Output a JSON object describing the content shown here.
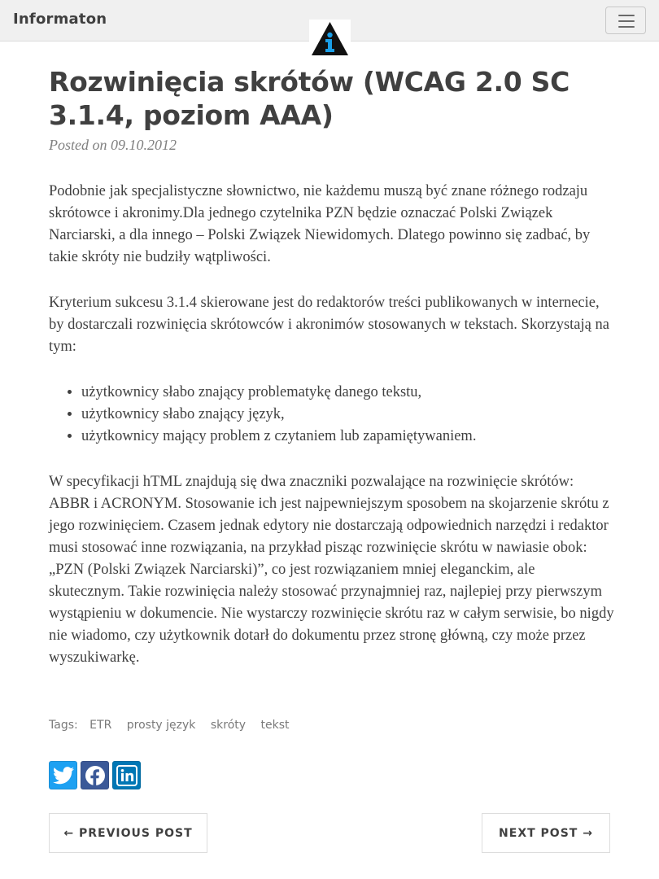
{
  "navbar": {
    "brand": "Informaton",
    "logo_icon": "info-triangle-logo",
    "menu_icon": "hamburger-menu-icon"
  },
  "post": {
    "title": "Rozwinięcia skrótów (WCAG 2.0 SC 3.1.4, poziom AAA)",
    "meta": "Posted on 09.10.2012",
    "paragraphs": [
      "Podobnie jak specjalistyczne słownictwo, nie każdemu muszą być znane różnego rodzaju skrótowce i akronimy.Dla jednego czytelnika PZN będzie oznaczać Polski Związek Narciarski, a dla innego – Polski Związek Niewidomych. Dlatego powinno się zadbać, by takie skróty nie budziły wątpliwości.",
      "Kryterium sukcesu 3.1.4 skierowane jest do redaktorów treści publikowanych w internecie, by dostarczali rozwinięcia skrótowców i akronimów stosowanych w tekstach. Skorzystają na tym:",
      "W specyfikacji hTML znajdują się dwa znaczniki pozwalające na rozwinięcie skrótów: ABBR i ACRONYM. Stosowanie ich jest najpewniejszym sposobem na skojarzenie skrótu z jego rozwinięciem. Czasem jednak edytory nie dostarczają odpowiednich narzędzi i redaktor musi stosować inne rozwiązania, na przykład pisząc rozwinięcie skrótu w nawiasie obok: „PZN (Polski Związek Narciarski)”, co jest rozwiązaniem mniej eleganckim, ale skutecznym. Takie rozwinięcia należy stosować przynajmniej raz, najlepiej przy pierwszym wystąpieniu w dokumencie. Nie wystarczy rozwinięcie skrótu raz w całym serwisie, bo nigdy nie wiadomo, czy użytkownik dotarł do dokumentu przez stronę główną, czy może przez wyszukiwarkę."
    ],
    "list_items": [
      "użytkownicy słabo znający problematykę danego tekstu,",
      "użytkownicy słabo znający język,",
      "użytkownicy mający problem z czytaniem lub zapamiętywaniem."
    ]
  },
  "tags": {
    "label": "Tags:",
    "items": [
      "ETR",
      "prosty język",
      "skróty",
      "tekst"
    ]
  },
  "share": {
    "icons": [
      "twitter-icon",
      "facebook-icon",
      "linkedin-icon"
    ],
    "colors": {
      "twitter": "#1da1f2",
      "facebook": "#3b5998",
      "linkedin": "#0077b5"
    }
  },
  "pager": {
    "previous": "← Previous Post",
    "next": "Next Post →"
  }
}
